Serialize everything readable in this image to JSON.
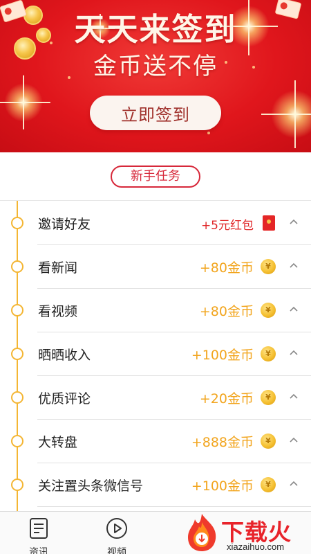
{
  "banner": {
    "title": "天天来签到",
    "subtitle": "金币送不停",
    "sign_button": "立即签到"
  },
  "section": {
    "header": "新手任务"
  },
  "tasks": [
    {
      "name": "邀请好友",
      "reward": "+5元红包",
      "reward_icon": "hongbao-icon"
    },
    {
      "name": "看新闻",
      "reward": "+80金币",
      "reward_icon": "coin-icon"
    },
    {
      "name": "看视频",
      "reward": "+80金币",
      "reward_icon": "coin-icon"
    },
    {
      "name": "晒晒收入",
      "reward": "+100金币",
      "reward_icon": "coin-icon"
    },
    {
      "name": "优质评论",
      "reward": "+20金币",
      "reward_icon": "coin-icon"
    },
    {
      "name": "大转盘",
      "reward": "+888金币",
      "reward_icon": "coin-icon"
    },
    {
      "name": "关注置头条微信号",
      "reward": "+100金币",
      "reward_icon": "coin-icon"
    }
  ],
  "coin_symbol": "¥",
  "bottom_nav": [
    {
      "label": "资讯",
      "icon": "document-icon"
    },
    {
      "label": "视频",
      "icon": "play-circle-icon"
    }
  ],
  "watermark": {
    "text": "下载火",
    "url": "xiazaihuo.com"
  },
  "colors": {
    "banner_red": "#e0161c",
    "accent_red": "#d7283a",
    "reward_gold": "#f2a51e",
    "timeline_gold": "#f4b634"
  }
}
